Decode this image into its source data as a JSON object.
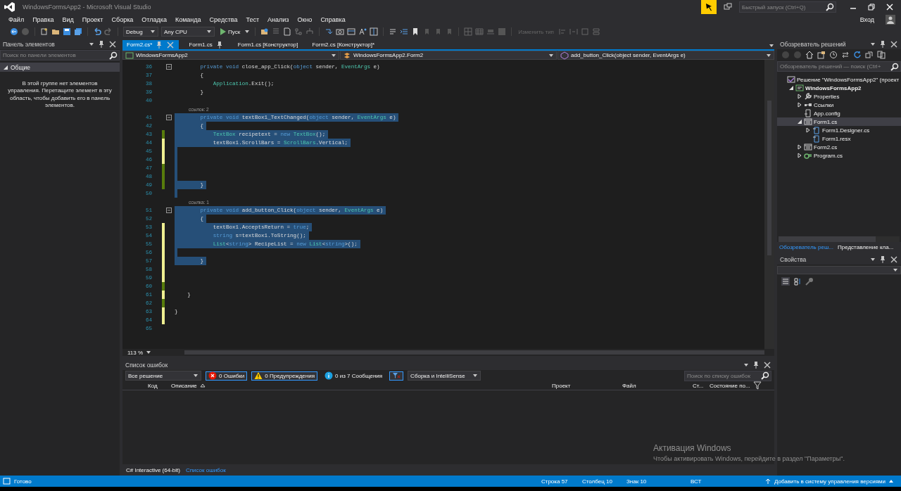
{
  "window": {
    "title": "WindowsFormsApp2 - Microsoft Visual Studio",
    "quick_launch_placeholder": "Быстрый запуск (Ctrl+Q)",
    "sign_in": "Вход"
  },
  "menu": [
    "Файл",
    "Правка",
    "Вид",
    "Проект",
    "Сборка",
    "Отладка",
    "Команда",
    "Средства",
    "Тест",
    "Анализ",
    "Окно",
    "Справка"
  ],
  "toolbar": {
    "configuration": "Debug",
    "platform": "Any CPU",
    "start": "Пуск",
    "change_type": {
      "label": "Изменить тип",
      "disabled": true
    }
  },
  "toolbox": {
    "title": "Панель элементов",
    "search_placeholder": "Поиск по панели элементов",
    "group": {
      "label": "Общие",
      "expanded": true
    },
    "message": "В этой группе нет элементов управления. Перетащите элемент в эту область, чтобы добавить его в панель элементов."
  },
  "doc_tabs": [
    {
      "label": "Form2.cs*",
      "selected": true,
      "pinned": false
    },
    {
      "label": "Form1.cs",
      "selected": false,
      "pinned": true
    },
    {
      "label": "Form1.cs [Конструктор]",
      "selected": false,
      "pinned": false
    },
    {
      "label": "Form2.cs [Конструктор]*",
      "selected": false,
      "pinned": false
    }
  ],
  "nav_bar": {
    "project": "WindowsFormsApp2",
    "class": "WindowsFormsApp2.Form2",
    "member": "add_button_Click(object sender, EventArgs e)"
  },
  "editor": {
    "zoom": "113 %",
    "lines": [
      {
        "kind": "code",
        "number": "36",
        "foldable": true,
        "selected": false,
        "tokens": [
          {
            "kind": "keyword",
            "text": "        private void"
          },
          {
            "kind": "text",
            "text": " close_app_Click("
          },
          {
            "kind": "keyword",
            "text": "object"
          },
          {
            "kind": "text",
            "text": " sender, "
          },
          {
            "kind": "type",
            "text": "EventArgs"
          },
          {
            "kind": "text",
            "text": " e)"
          }
        ]
      },
      {
        "kind": "code",
        "number": "37",
        "foldable": false,
        "selected": false,
        "tokens": [
          {
            "kind": "text",
            "text": "        {"
          }
        ]
      },
      {
        "kind": "code",
        "number": "38",
        "foldable": false,
        "selected": false,
        "tokens": [
          {
            "kind": "type",
            "text": "            Application"
          },
          {
            "kind": "text",
            "text": ".Exit();"
          }
        ]
      },
      {
        "kind": "code",
        "number": "39",
        "foldable": false,
        "selected": false,
        "tokens": [
          {
            "kind": "text",
            "text": "        }"
          }
        ]
      },
      {
        "kind": "code",
        "number": "40",
        "foldable": false,
        "selected": false
      },
      {
        "kind": "lens",
        "text": "ссылок: 2"
      },
      {
        "kind": "code",
        "number": "41",
        "foldable": true,
        "selected": true,
        "tokens": [
          {
            "kind": "keyword",
            "text": "        private void"
          },
          {
            "kind": "text",
            "text": " textBox1_TextChanged("
          },
          {
            "kind": "keyword",
            "text": "object"
          },
          {
            "kind": "text",
            "text": " sender, "
          },
          {
            "kind": "type",
            "text": "EventArgs"
          },
          {
            "kind": "text",
            "text": " e)"
          }
        ]
      },
      {
        "kind": "code",
        "number": "42",
        "foldable": false,
        "selected": true,
        "tokens": [
          {
            "kind": "text",
            "text": "        {"
          }
        ]
      },
      {
        "kind": "code",
        "number": "43",
        "color": "#587c0c",
        "foldable": false,
        "selected": true,
        "tokens": [
          {
            "kind": "type",
            "text": "            TextBox"
          },
          {
            "kind": "text",
            "text": " recipetext = "
          },
          {
            "kind": "keyword",
            "text": "new"
          },
          {
            "kind": "type",
            "text": " TextBox"
          },
          {
            "kind": "text",
            "text": "();"
          }
        ]
      },
      {
        "kind": "code",
        "number": "44",
        "color": "#efef91",
        "foldable": false,
        "selected": true,
        "tokens": [
          {
            "kind": "text",
            "text": "            textBox1.ScrollBars = "
          },
          {
            "kind": "type",
            "text": "ScrollBars"
          },
          {
            "kind": "text",
            "text": ".Vertical;"
          }
        ]
      },
      {
        "kind": "code",
        "number": "45",
        "color": "#efef91",
        "foldable": false,
        "selected": true
      },
      {
        "kind": "code",
        "number": "46",
        "color": "#efef91",
        "foldable": false,
        "selected": true
      },
      {
        "kind": "code",
        "number": "47",
        "color": "#587c0c",
        "foldable": false,
        "selected": true
      },
      {
        "kind": "code",
        "number": "48",
        "color": "#587c0c",
        "foldable": false,
        "selected": true
      },
      {
        "kind": "code",
        "number": "49",
        "color": "#587c0c",
        "foldable": false,
        "selected": true,
        "tokens": [
          {
            "kind": "text",
            "text": "        }"
          }
        ]
      },
      {
        "kind": "code",
        "number": "50",
        "foldable": false,
        "selected": true
      },
      {
        "kind": "lens",
        "text": "ссылка: 1"
      },
      {
        "kind": "code",
        "number": "51",
        "foldable": true,
        "selected": true,
        "tokens": [
          {
            "kind": "keyword",
            "text": "        private void"
          },
          {
            "kind": "text",
            "text": " add_button_Click("
          },
          {
            "kind": "keyword",
            "text": "object"
          },
          {
            "kind": "text",
            "text": " sender, "
          },
          {
            "kind": "type",
            "text": "EventArgs"
          },
          {
            "kind": "text",
            "text": " e)"
          }
        ]
      },
      {
        "kind": "code",
        "number": "52",
        "foldable": false,
        "selected": true,
        "tokens": [
          {
            "kind": "text",
            "text": "        {"
          }
        ]
      },
      {
        "kind": "code",
        "number": "53",
        "color": "#efef91",
        "foldable": false,
        "selected": true,
        "tokens": [
          {
            "kind": "text",
            "text": "            textBox1.AcceptsReturn = "
          },
          {
            "kind": "keyword",
            "text": "true"
          },
          {
            "kind": "text",
            "text": ";"
          }
        ]
      },
      {
        "kind": "code",
        "number": "54",
        "color": "#efef91",
        "foldable": false,
        "selected": true,
        "tokens": [
          {
            "kind": "keyword",
            "text": "            string"
          },
          {
            "kind": "text",
            "text": " s=textBox1.ToString();"
          }
        ]
      },
      {
        "kind": "code",
        "number": "55",
        "color": "#efef91",
        "foldable": false,
        "selected": true,
        "tokens": [
          {
            "kind": "type",
            "text": "            List"
          },
          {
            "kind": "text",
            "text": "<"
          },
          {
            "kind": "keyword",
            "text": "string"
          },
          {
            "kind": "text",
            "text": "> RecipeList = "
          },
          {
            "kind": "keyword",
            "text": "new"
          },
          {
            "kind": "type",
            "text": " List"
          },
          {
            "kind": "text",
            "text": "<"
          },
          {
            "kind": "keyword",
            "text": "string"
          },
          {
            "kind": "text",
            "text": ">();"
          }
        ]
      },
      {
        "kind": "code",
        "number": "56",
        "color": "#efef91",
        "foldable": false,
        "selected": true
      },
      {
        "kind": "code",
        "number": "57",
        "color": "#efef91",
        "foldable": false,
        "selected": true,
        "tokens": [
          {
            "kind": "text",
            "text": "        }"
          }
        ]
      },
      {
        "kind": "code",
        "number": "58",
        "color": "#efef91",
        "foldable": false,
        "selected": false
      },
      {
        "kind": "code",
        "number": "59",
        "color": "#efef91",
        "foldable": false,
        "selected": false
      },
      {
        "kind": "code",
        "number": "60",
        "color": "#587c0c",
        "foldable": false,
        "selected": false
      },
      {
        "kind": "code",
        "number": "61",
        "color": "#efef91",
        "foldable": false,
        "selected": false,
        "tokens": [
          {
            "kind": "text",
            "text": "    }"
          }
        ]
      },
      {
        "kind": "code",
        "number": "62",
        "color": "#587c0c",
        "foldable": false,
        "selected": false
      },
      {
        "kind": "code",
        "number": "63",
        "color": "#efef91",
        "foldable": false,
        "selected": false,
        "tokens": [
          {
            "kind": "text",
            "text": "}"
          }
        ]
      },
      {
        "kind": "code",
        "number": "64",
        "color": "#efef91",
        "foldable": false,
        "selected": false
      },
      {
        "kind": "code",
        "number": "65",
        "foldable": false,
        "selected": false
      }
    ]
  },
  "error_list": {
    "title": "Список ошибок",
    "scope": "Все решение",
    "filters": [
      {
        "kind": "error",
        "label": "0 Ошибки",
        "selected": true
      },
      {
        "kind": "warning",
        "label": "0 Предупреждения",
        "selected": true
      },
      {
        "kind": "info",
        "label": "0 из 7 Сообщения",
        "selected": false
      }
    ],
    "source": "Сборка и IntelliSense",
    "search_placeholder": "Поиск по списку ошибок",
    "columns": [
      {
        "label": "Код",
        "sorted": false
      },
      {
        "label": "Описание",
        "sorted": true
      },
      {
        "label": "Проект",
        "sorted": false
      },
      {
        "label": "Файл",
        "sorted": false
      },
      {
        "label": "Ст...",
        "sorted": false
      },
      {
        "label": "Состояние по...",
        "sorted": false
      }
    ]
  },
  "bottom_tabs": [
    {
      "label": "C# Interactive (64-bit)",
      "selected": false
    },
    {
      "label": "Список ошибок",
      "selected": true
    }
  ],
  "solution_explorer": {
    "title": "Обозреватель решений",
    "search_placeholder": "Обозреватель решений — поиск (Ctrl+",
    "tree": [
      {
        "kind": "solution",
        "label": "Решение \"WindowsFormsApp2\"  (проект",
        "selected": false,
        "children": [
          {
            "kind": "project",
            "label": "WindowsFormsApp2",
            "expanded": true,
            "selected": false,
            "children": [
              {
                "kind": "properties",
                "label": "Properties",
                "expanded": false,
                "selected": false
              },
              {
                "kind": "references",
                "label": "Ссылки",
                "expanded": false,
                "selected": false
              },
              {
                "kind": "config",
                "label": "App.config",
                "selected": false
              },
              {
                "kind": "form",
                "label": "Form1.cs",
                "expanded": true,
                "selected": true,
                "children": [
                  {
                    "kind": "file",
                    "label": "Form1.Designer.cs",
                    "expanded": false,
                    "selected": false
                  },
                  {
                    "kind": "file",
                    "label": "Form1.resx",
                    "selected": false
                  }
                ]
              },
              {
                "kind": "form",
                "label": "Form2.cs",
                "expanded": false,
                "selected": false
              },
              {
                "kind": "csharp",
                "label": "Program.cs",
                "expanded": false,
                "selected": false
              }
            ]
          }
        ]
      }
    ],
    "tabs": [
      {
        "label": "Обозреватель реш...",
        "selected": true
      },
      {
        "label": "Представление кла...",
        "selected": false
      }
    ]
  },
  "properties": {
    "title": "Свойства"
  },
  "activation_notice": {
    "title": "Активация Windows",
    "text": "Чтобы активировать Windows, перейдите в раздел \"Параметры\"."
  },
  "status_bar": {
    "state": "Готово",
    "line": "Строка 57",
    "column": "Столбец 10",
    "char": "Знак 10",
    "mode": "ВСТ",
    "source_control": "Добавить в систему управления версиями"
  }
}
